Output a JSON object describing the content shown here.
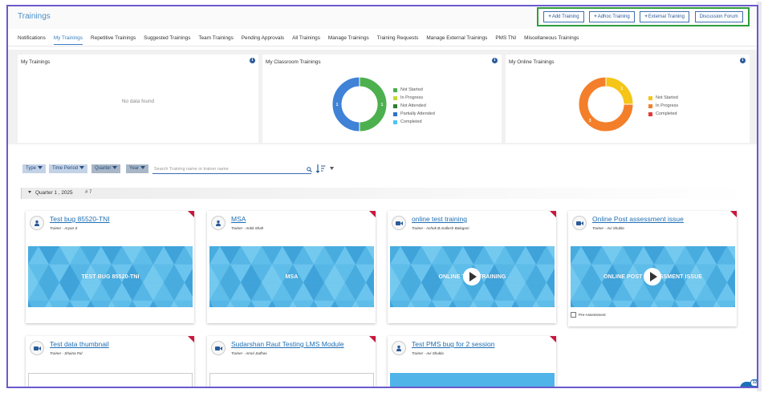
{
  "header": {
    "title": "Trainings",
    "actions": [
      {
        "label": "Add Training",
        "icon": "plus-icon"
      },
      {
        "label": "Adhoc Training",
        "icon": "plus-icon"
      },
      {
        "label": "External Training",
        "icon": "plus-icon"
      },
      {
        "label": "Discussion Forum",
        "icon": ""
      }
    ]
  },
  "tabs": [
    {
      "label": "Notifications"
    },
    {
      "label": "My Trainings",
      "active": true
    },
    {
      "label": "Repetitive Trainings"
    },
    {
      "label": "Suggested Trainings"
    },
    {
      "label": "Team Trainings"
    },
    {
      "label": "Pending Approvals"
    },
    {
      "label": "All Trainings"
    },
    {
      "label": "Manage Trainings"
    },
    {
      "label": "Training Requests"
    },
    {
      "label": "Manage External Trainings"
    },
    {
      "label": "PMS TNI"
    },
    {
      "label": "Miscellaneous Trainings"
    }
  ],
  "panels": {
    "my_trainings": {
      "title": "My Trainings",
      "empty_message": "No data found"
    },
    "classroom": {
      "title": "My Classroom Trainings",
      "legend": [
        {
          "label": "Not Started",
          "color": "#4caf50"
        },
        {
          "label": "In Progress",
          "color": "#c6d93a"
        },
        {
          "label": "Not Attended",
          "color": "#2e7d32"
        },
        {
          "label": "Partially Attended",
          "color": "#2f73c9"
        },
        {
          "label": "Completed",
          "color": "#4fc3f7"
        }
      ],
      "slices": [
        {
          "label": "1",
          "value": 1,
          "color": "#4cb04f"
        },
        {
          "label": "1",
          "value": 1,
          "color": "#3f82d6"
        }
      ]
    },
    "online": {
      "title": "My Online Trainings",
      "legend": [
        {
          "label": "Not Started",
          "color": "#f5c518"
        },
        {
          "label": "In Progress",
          "color": "#f47f2a"
        },
        {
          "label": "Completed",
          "color": "#e53935"
        }
      ],
      "slices": [
        {
          "label": "1",
          "value": 1,
          "color": "#f5c518"
        },
        {
          "label": "3",
          "value": 3,
          "color": "#f47f2a"
        }
      ]
    }
  },
  "filters": {
    "buttons": [
      {
        "label": "Type",
        "selected": false
      },
      {
        "label": "Time Period",
        "selected": false
      },
      {
        "label": "Quarter",
        "selected": true
      },
      {
        "label": "Year",
        "selected": true
      }
    ],
    "search_placeholder": "Search Training name or trainer name",
    "search_value": ""
  },
  "group": {
    "label": "Quarter 1 , 2025",
    "count": "# 7"
  },
  "cards": [
    {
      "title": "Test bug 85520-TNI",
      "trainer": "Trainer - Aryan S",
      "thumb_text": "TEST BUG 85520-TNI",
      "type": "classroom",
      "icon": "person-icon",
      "play": false,
      "pre_assessment": ""
    },
    {
      "title": "MSA",
      "trainer": "Trainer - Ankit Shah",
      "thumb_text": "MSA",
      "type": "classroom",
      "icon": "person-icon",
      "play": false,
      "pre_assessment": ""
    },
    {
      "title": "online test training",
      "trainer": "Trainer - Ashok B.mallesh Balegoni",
      "thumb_text": "ONLINE TEST TRAINING",
      "type": "online",
      "icon": "video-icon",
      "play": true,
      "pre_assessment": ""
    },
    {
      "title": "Online Post assessment issue",
      "trainer": "Trainer - Avi Shukla",
      "thumb_text": "ONLINE POST ASSESSMENT ISSUE",
      "type": "online",
      "icon": "video-icon",
      "play": true,
      "pre_assessment": "Pre-Assessment"
    },
    {
      "title": "Test data thumbnail",
      "trainer": "Trainer - Shaina Pal",
      "thumb_text": "",
      "type": "online",
      "icon": "video-icon",
      "play": false,
      "pre_assessment": ""
    },
    {
      "title": "Sudarshan Raut Testing LMS Module",
      "trainer": "Trainer - Amol Jadhav",
      "thumb_text": "",
      "type": "online",
      "icon": "video-icon",
      "play": false,
      "pre_assessment": ""
    },
    {
      "title": "Test PMS bug for 2 session",
      "trainer": "Trainer - Avi Shukla",
      "thumb_text": "",
      "type": "classroom",
      "icon": "person-icon",
      "play": false,
      "pre_assessment": ""
    }
  ],
  "chat": {
    "badge": "32"
  },
  "colors": {
    "accent": "#3a7fc0",
    "corner": "#c8173d",
    "thumb": "#50b4e8",
    "highlight": "#2e9e3a"
  }
}
